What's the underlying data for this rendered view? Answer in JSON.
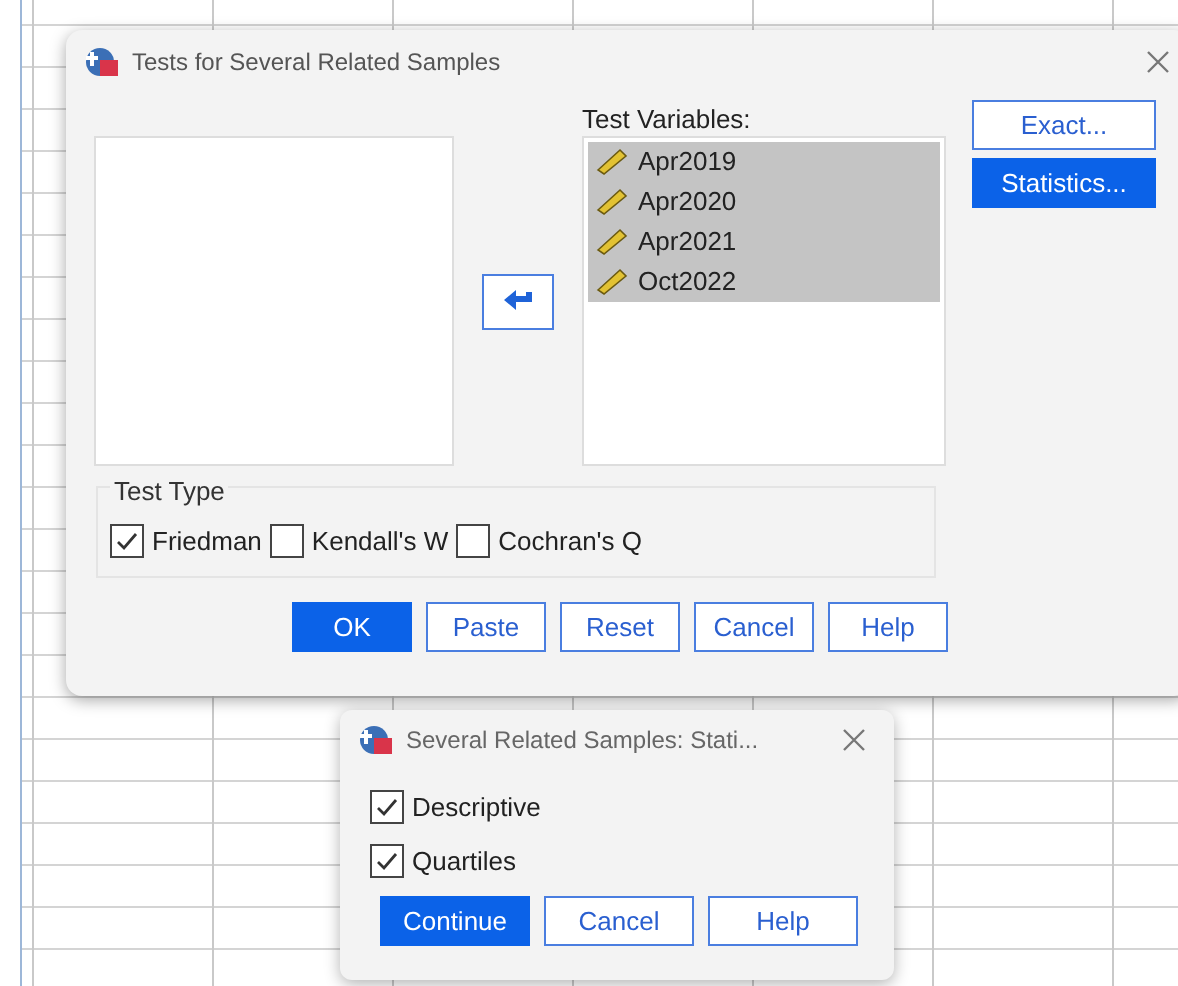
{
  "main_dialog": {
    "title": "Tests for Several Related Samples",
    "test_variables_label": "Test Variables:",
    "test_variables": [
      {
        "name": "Apr2019",
        "selected": true
      },
      {
        "name": "Apr2020",
        "selected": true
      },
      {
        "name": "Apr2021",
        "selected": true
      },
      {
        "name": "Oct2022",
        "selected": true
      }
    ],
    "side_buttons": [
      {
        "label": "Exact...",
        "primary": false
      },
      {
        "label": "Statistics...",
        "primary": true
      }
    ],
    "test_type": {
      "title": "Test Type",
      "options": [
        {
          "label": "Friedman",
          "checked": true
        },
        {
          "label": "Kendall's W",
          "checked": false
        },
        {
          "label": "Cochran's Q",
          "checked": false
        }
      ]
    },
    "buttons": [
      {
        "label": "OK",
        "primary": true
      },
      {
        "label": "Paste",
        "primary": false
      },
      {
        "label": "Reset",
        "primary": false
      },
      {
        "label": "Cancel",
        "primary": false
      },
      {
        "label": "Help",
        "primary": false
      }
    ]
  },
  "stats_dialog": {
    "title": "Several Related Samples: Stati...",
    "options": [
      {
        "label": "Descriptive",
        "checked": true
      },
      {
        "label": "Quartiles",
        "checked": true
      }
    ],
    "buttons": [
      {
        "label": "Continue",
        "primary": true
      },
      {
        "label": "Cancel",
        "primary": false
      },
      {
        "label": "Help",
        "primary": false
      }
    ]
  }
}
